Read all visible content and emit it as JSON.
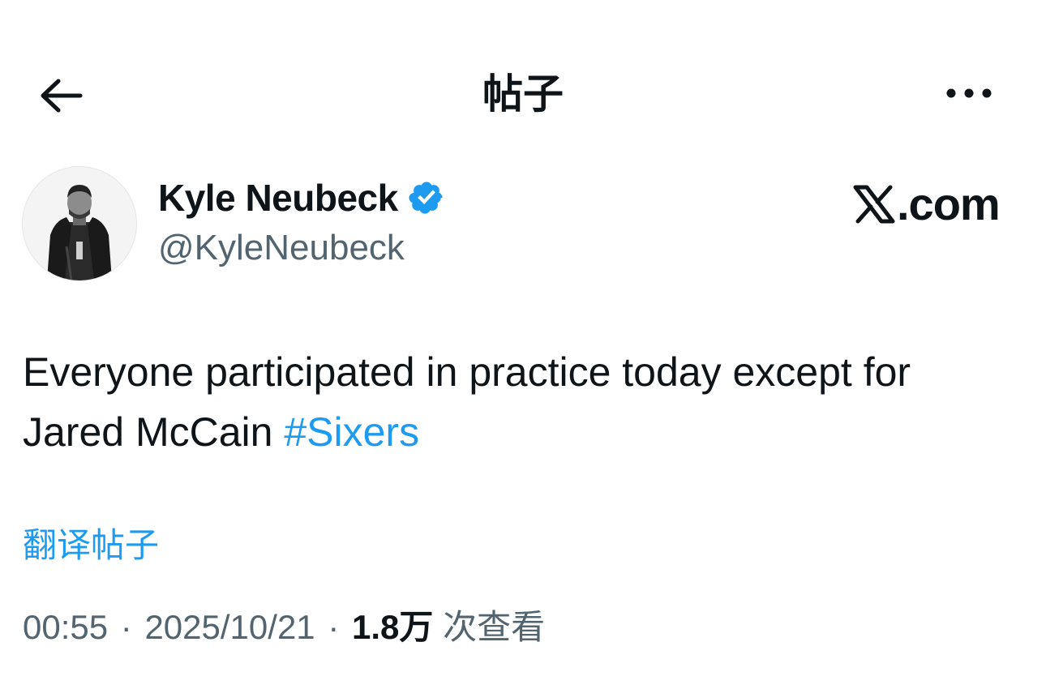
{
  "header": {
    "title": "帖子",
    "back_icon": "arrow-left-icon",
    "more_icon": "more-horizontal-icon"
  },
  "author": {
    "name": "Kyle Neubeck",
    "handle": "@KyleNeubeck",
    "verified": true,
    "verified_color": "#1d9bf0",
    "avatar_icon": "profile-photo"
  },
  "brand": {
    "logo_icon": "x-logo-icon",
    "text": ".com"
  },
  "tweet": {
    "text": "Everyone participated in practice today except for Jared McCain ",
    "hashtag": "#Sixers",
    "hashtag_color": "#1d9bf0"
  },
  "translate_label": "翻译帖子",
  "meta": {
    "time": "00:55",
    "separator": "·",
    "date": "2025/10/21",
    "views_count": "1.8万",
    "views_label": "次查看"
  }
}
